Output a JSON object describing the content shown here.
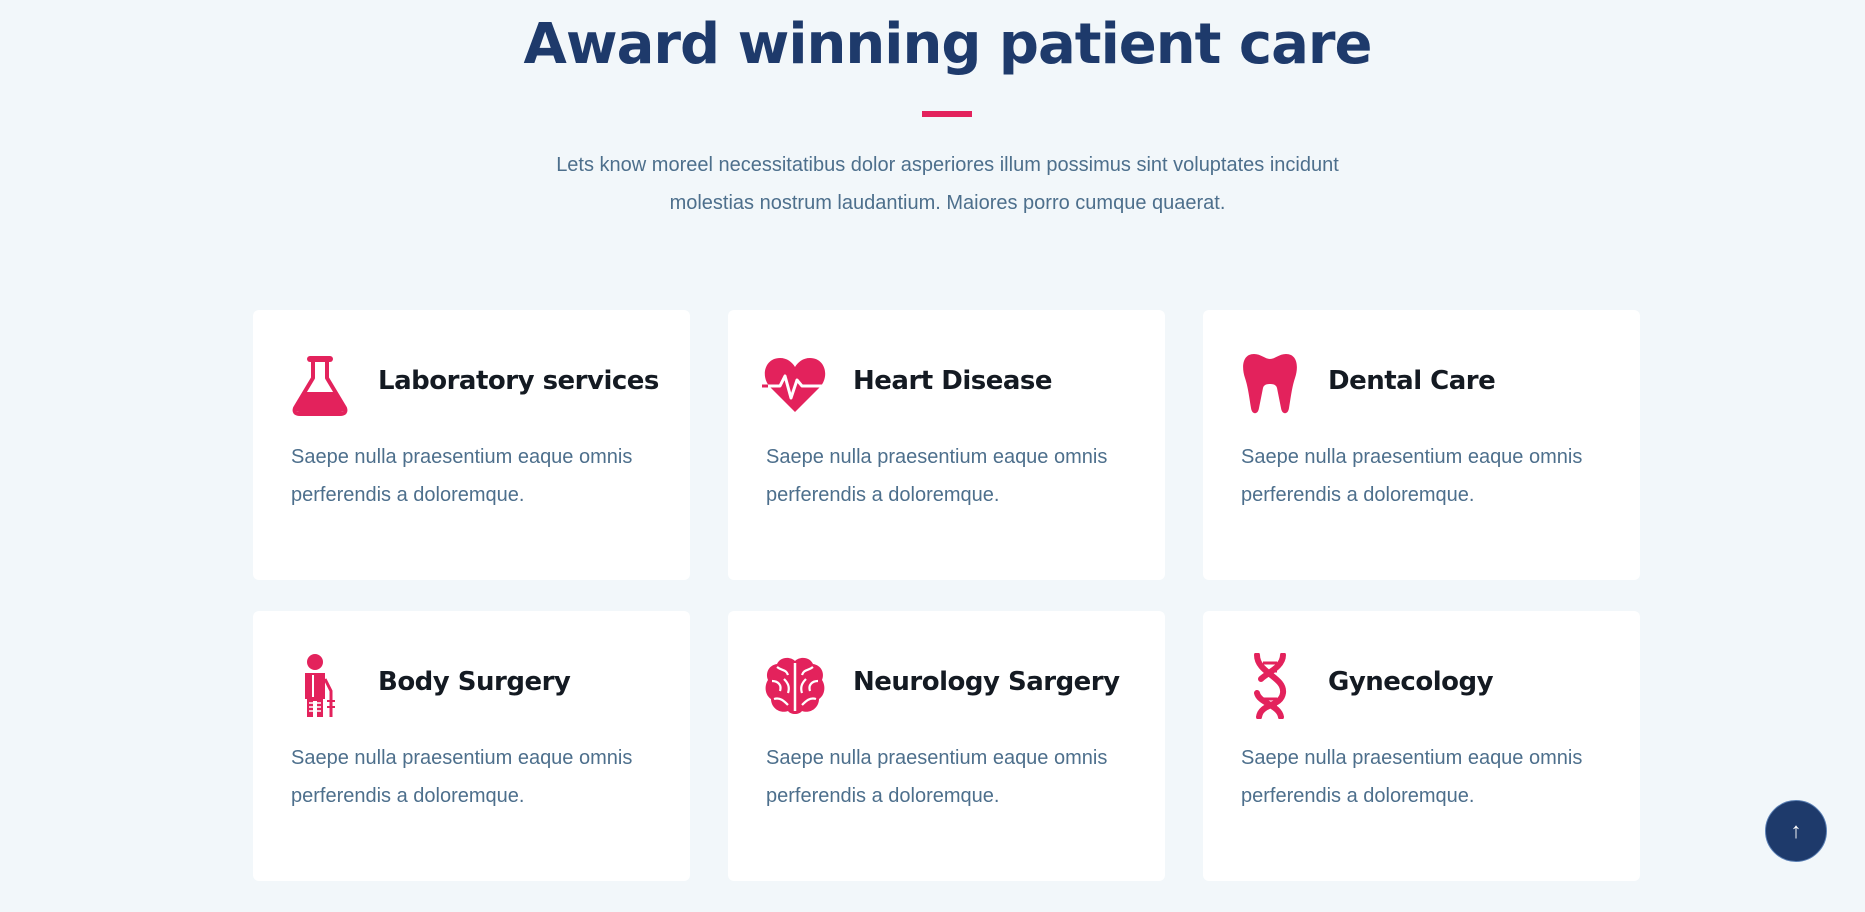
{
  "section": {
    "title": "Award winning patient care",
    "description": "Lets know moreel necessitatibus dolor asperiores illum possimus sint voluptates incidunt molestias nostrum laudantium. Maiores porro cumque quaerat."
  },
  "theme": {
    "accent": "#e3225c",
    "heading": "#1e3a6b",
    "text": "#4d6f8c",
    "background": "#f2f7fa"
  },
  "cards": [
    {
      "icon": "flask-icon",
      "title": "Laboratory services",
      "text": "Saepe nulla praesentium eaque omnis perferendis a doloremque."
    },
    {
      "icon": "heartbeat-icon",
      "title": "Heart Disease",
      "text": "Saepe nulla praesentium eaque omnis perferendis a doloremque."
    },
    {
      "icon": "tooth-icon",
      "title": "Dental Care",
      "text": "Saepe nulla praesentium eaque omnis perferendis a doloremque."
    },
    {
      "icon": "patient-icon",
      "title": "Body Surgery",
      "text": "Saepe nulla praesentium eaque omnis perferendis a doloremque."
    },
    {
      "icon": "brain-icon",
      "title": "Neurology Sargery",
      "text": "Saepe nulla praesentium eaque omnis perferendis a doloremque."
    },
    {
      "icon": "dna-icon",
      "title": "Gynecology",
      "text": "Saepe nulla praesentium eaque omnis perferendis a doloremque."
    }
  ],
  "scroll_top": {
    "icon": "arrow-up-icon",
    "glyph": "↑"
  }
}
